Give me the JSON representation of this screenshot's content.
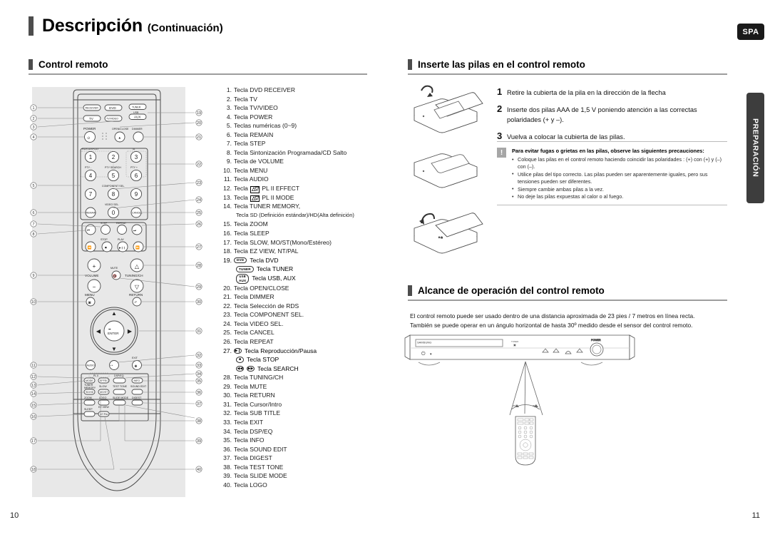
{
  "header": {
    "title_main": "Descripción",
    "title_sub": "(Continuación)",
    "spa_tab": "SPA",
    "side_tab": "PREPARACIÓN"
  },
  "sections": {
    "remote": {
      "title": "Control remoto"
    },
    "batteries": {
      "title": "Inserte las pilas en el control remoto"
    },
    "range": {
      "title": "Alcance de operación del control remoto"
    }
  },
  "remote_keys": [
    {
      "n": "1.",
      "text": "Tecla DVD RECEIVER"
    },
    {
      "n": "2.",
      "text": "Tecla TV"
    },
    {
      "n": "3.",
      "text": "Tecla TV/VIDEO"
    },
    {
      "n": "4.",
      "text": "Tecla POWER"
    },
    {
      "n": "5.",
      "text": "Teclas numéricas (0~9)"
    },
    {
      "n": "6.",
      "text": "Tecla REMAIN"
    },
    {
      "n": "7.",
      "text": "Tecla STEP"
    },
    {
      "n": "8.",
      "text": "Tecla Sintonización Programada/CD Salto"
    },
    {
      "n": "9.",
      "text": "Tecla de VOLUME"
    },
    {
      "n": "10.",
      "text": "Tecla MENU"
    },
    {
      "n": "11.",
      "text": "Tecla AUDIO"
    },
    {
      "n": "12.",
      "text": "Tecla",
      "dolby": true,
      "after": "PL II EFFECT"
    },
    {
      "n": "13.",
      "text": "Tecla",
      "dolby": true,
      "after": "PL II MODE"
    },
    {
      "n": "14.",
      "text": "Tecla TUNER MEMORY,",
      "sub": "Tecla SD (Definición estándar)/HD(Alta definición)"
    },
    {
      "n": "15.",
      "text": "Tecla ZOOM"
    },
    {
      "n": "16.",
      "text": "Tecla SLEEP"
    },
    {
      "n": "17.",
      "text": "Tecla SLOW, MO/ST(Mono/Estéreo)"
    },
    {
      "n": "18.",
      "text": "Tecla EZ VIEW, NT/PAL"
    },
    {
      "n": "19.",
      "pill": "DVD",
      "text": "Tecla DVD"
    },
    {
      "n": "",
      "pill": "TUNER",
      "text": "Tecla TUNER"
    },
    {
      "n": "",
      "pill2_top": "USB",
      "pill2_bot": "AUX",
      "text": "Tecla USB, AUX"
    },
    {
      "n": "20.",
      "text": "Tecla OPEN/CLOSE"
    },
    {
      "n": "21.",
      "text": "Tecla DIMMER"
    },
    {
      "n": "22.",
      "text": "Tecla Selección de RDS"
    },
    {
      "n": "23.",
      "text": "Tecla COMPONENT SEL."
    },
    {
      "n": "24.",
      "text": "Tecla VIDEO SEL."
    },
    {
      "n": "25.",
      "text": "Tecla CANCEL"
    },
    {
      "n": "26.",
      "text": "Tecla REPEAT"
    },
    {
      "n": "27.",
      "glyph": "▶❙",
      "text": "Tecla Reproducción/Pausa"
    },
    {
      "n": "",
      "glyph": "■",
      "text": "Tecla STOP"
    },
    {
      "n": "",
      "glyph2": [
        "◀◀",
        "▶▶"
      ],
      "text": "Tecla SEARCH"
    },
    {
      "n": "28.",
      "text": "Tecla TUNING/CH"
    },
    {
      "n": "29.",
      "text": "Tecla MUTE"
    },
    {
      "n": "30.",
      "text": "Tecla RETURN"
    },
    {
      "n": "31.",
      "text": "Tecla Cursor/Intro"
    },
    {
      "n": "32.",
      "text": "Tecla SUB TITLE"
    },
    {
      "n": "33.",
      "text": "Tecla EXIT"
    },
    {
      "n": "34.",
      "text": "Tecla DSP/EQ"
    },
    {
      "n": "35.",
      "text": "Tecla INFO"
    },
    {
      "n": "36.",
      "text": "Tecla SOUND EDIT"
    },
    {
      "n": "37.",
      "text": "Tecla DIGEST"
    },
    {
      "n": "38.",
      "text": "Tecla TEST TONE"
    },
    {
      "n": "39.",
      "text": "Tecla SLIDE MODE"
    },
    {
      "n": "40.",
      "text": "Tecla LOGO"
    }
  ],
  "remote_labels": {
    "receiver": "RECEIVER",
    "dvd": "DVD",
    "tuner": "TUNER",
    "usb": "USB",
    "aux": "AUX",
    "tv": "TV",
    "tvvideo": "TV/VIDEO",
    "power": "POWER",
    "open_close": "OPEN/CLOSE",
    "dimmer": "DIMMER",
    "rds_display": "RDS DISPLAY",
    "ta": "TA",
    "pty_minus": "PTY -",
    "pty_search": "PTY SEARCH",
    "pty_plus": "PTY +",
    "component_sel": "COMPONENT SEL.",
    "video_sel": "VIDEO SEL.",
    "remain": "REMAIN",
    "cancel": "CANCEL",
    "step": "STEP",
    "repeat": "REPEAT",
    "stop": "STOP",
    "play": "PLAY",
    "volume": "VOLUME",
    "mute": "MUTE",
    "tuning_ch": "TUNING/CH",
    "menu": "MENU",
    "return": "RETURN",
    "enter": "ENTER",
    "audio": "AUDIO",
    "subtitle": "SUB TITLE",
    "exit": "EXIT",
    "plii": "PL II",
    "mode": "MODE",
    "effect": "EFFECT",
    "dsp_eq": "DSP/EQ",
    "info": "INFO",
    "tuner_memory": "TUNER MEMORY",
    "sd_hd": "SD/HD",
    "slow": "SLOW",
    "mo_st": "MO/ST",
    "test_tone": "TEST TONE",
    "sound_edit": "SOUND EDIT",
    "zoom": "ZOOM",
    "logo": "LOGO",
    "slide_mode": "SLIDE MODE",
    "digest": "DIGEST",
    "sleep": "SLEEP",
    "ez_view": "EZ VIEW",
    "nt_pal": "NT/PAL",
    "digits": [
      "1",
      "2",
      "3",
      "4",
      "5",
      "6",
      "7",
      "8",
      "9",
      "0"
    ]
  },
  "callouts_left": [
    "1",
    "2",
    "3",
    "4",
    "5",
    "6",
    "7",
    "8",
    "9",
    "10",
    "11",
    "12",
    "13",
    "14",
    "15",
    "16",
    "17",
    "18"
  ],
  "callouts_right": [
    "19",
    "20",
    "21",
    "22",
    "23",
    "24",
    "25",
    "26",
    "27",
    "28",
    "29",
    "30",
    "31",
    "32",
    "33",
    "34",
    "35",
    "36",
    "37",
    "38",
    "39",
    "40"
  ],
  "battery_steps": [
    {
      "n": "1",
      "text": "Retire la cubierta de la pila en la dirección de la flecha"
    },
    {
      "n": "2",
      "text": "Inserte dos pilas AAA de 1,5 V poniendo atención a las correctas polaridades (+ y –)."
    },
    {
      "n": "3",
      "text": "Vuelva a colocar la cubierta de las pilas."
    }
  ],
  "caution": {
    "icon": "!",
    "title": "Para evitar fugas o grietas en las pilas, observe las siguientes precauciones:",
    "items": [
      "Coloque las pilas en el control remoto haciendo coincidir las polaridades : (+) con (+) y (–) con (–).",
      "Utilice pilas del tipo correcto. Las pilas pueden ser aparentemente iguales, pero sus tensiones pueden ser diferentes.",
      "Siempre cambie ambas pilas a la vez.",
      "No deje las pilas expuestas al calor o al fuego."
    ]
  },
  "range": {
    "line1": "El control remoto puede ser usado dentro de una distancia aproximada de 23 pies / 7 metros en línea recta.",
    "line2": "También se puede operar en un ángulo horizontal de hasta 30º medido desde el sensor del control remoto.",
    "device_brand": "SAMSUNG"
  },
  "page_numbers": {
    "left": "10",
    "right": "11"
  }
}
